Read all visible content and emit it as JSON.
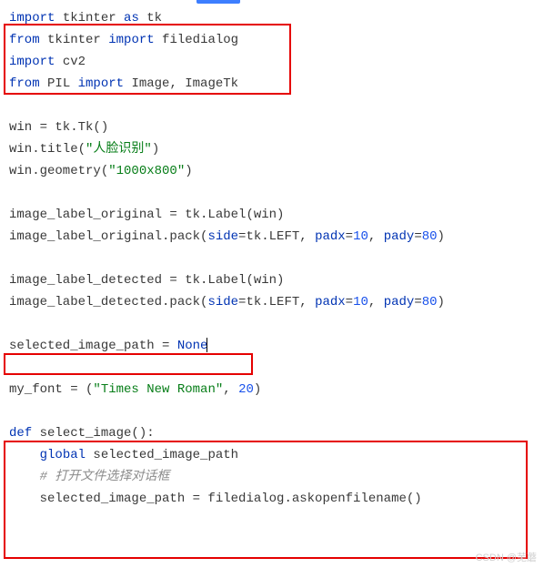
{
  "code": {
    "l1a": "import",
    "l1b": " tkinter ",
    "l1c": "as",
    "l1d": " tk",
    "l2a": "from",
    "l2b": " tkinter ",
    "l2c": "import",
    "l2d": " filedialog",
    "l3a": "import",
    "l3b": " cv2",
    "l4a": "from",
    "l4b": " PIL ",
    "l4c": "import",
    "l4d": " Image, ImageTk",
    "l6": "win = tk.Tk()",
    "l7a": "win.title(",
    "l7b": "\"人脸识别\"",
    "l7c": ")",
    "l8a": "win.geometry(",
    "l8b": "\"1000x800\"",
    "l8c": ")",
    "l10": "image_label_original = tk.Label(win)",
    "l11a": "image_label_original.pack(",
    "l11b": "side",
    "l11c": "=tk.LEFT, ",
    "l11d": "padx",
    "l11e": "=",
    "l11f": "10",
    "l11g": ", ",
    "l11h": "pady",
    "l11i": "=",
    "l11j": "80",
    "l11k": ")",
    "l13": "image_label_detected = tk.Label(win)",
    "l14a": "image_label_detected.pack(",
    "l14b": "side",
    "l14c": "=tk.LEFT, ",
    "l14d": "padx",
    "l14e": "=",
    "l14f": "10",
    "l14g": ", ",
    "l14h": "pady",
    "l14i": "=",
    "l14j": "80",
    "l14k": ")",
    "l16a": "selected_image_path = ",
    "l16b": "None",
    "l18a": "my_font = (",
    "l18b": "\"Times New Roman\"",
    "l18c": ", ",
    "l18d": "20",
    "l18e": ")",
    "l20a": "def ",
    "l20b": "select_image():",
    "l21a": "    ",
    "l21b": "global",
    "l21c": " selected_image_path",
    "l22a": "    ",
    "l22b": "# 打开文件选择对话框",
    "l23": "    selected_image_path = filedialog.askopenfilename()"
  },
  "watermark": "CSDN @芜蘑"
}
